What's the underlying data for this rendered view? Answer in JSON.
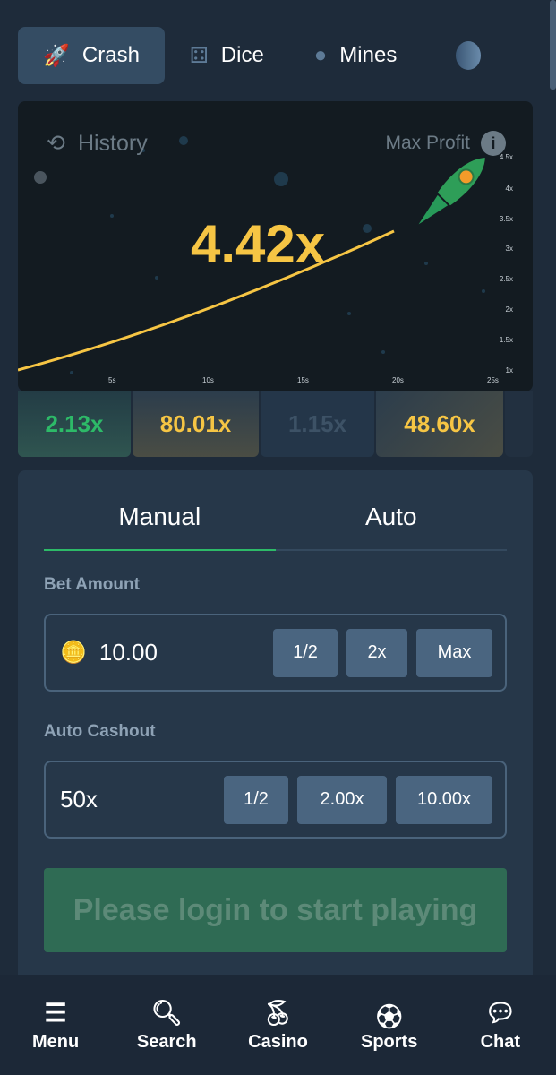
{
  "game_tabs": [
    {
      "label": "Crash",
      "icon": "rocket-icon",
      "active": true
    },
    {
      "label": "Dice",
      "icon": "dice-icon"
    },
    {
      "label": "Mines",
      "icon": "bomb-icon"
    }
  ],
  "chart": {
    "history_label": "History",
    "max_profit_label": "Max Profit",
    "multiplier": "4.42x",
    "y_ticks": [
      "4.5x",
      "4x",
      "3.5x",
      "3x",
      "2.5x",
      "2x",
      "1.5x",
      "1x"
    ],
    "x_ticks": [
      "5s",
      "10s",
      "15s",
      "20s",
      "25s"
    ]
  },
  "history": [
    {
      "value": "2.13x",
      "color": "#2dba68"
    },
    {
      "value": "80.01x",
      "color": "#f6c544"
    },
    {
      "value": "1.15x",
      "color": "#3d5266"
    },
    {
      "value": "48.60x",
      "color": "#f6c544"
    }
  ],
  "bet_panel": {
    "tabs": [
      "Manual",
      "Auto"
    ],
    "active_tab": "Manual",
    "bet_amount_label": "Bet Amount",
    "bet_amount": "10.00",
    "bet_buttons": [
      "1/2",
      "2x",
      "Max"
    ],
    "auto_cashout_label": "Auto Cashout",
    "auto_cashout": "50x",
    "cashout_buttons": [
      "1/2",
      "2.00x",
      "10.00x"
    ],
    "login_button": "Please login to start playing"
  },
  "nav": [
    {
      "label": "Menu",
      "icon": "menu-icon"
    },
    {
      "label": "Search",
      "icon": "search-icon"
    },
    {
      "label": "Casino",
      "icon": "cherry-icon"
    },
    {
      "label": "Sports",
      "icon": "soccer-ball-icon"
    },
    {
      "label": "Chat",
      "icon": "chat-icon"
    }
  ]
}
